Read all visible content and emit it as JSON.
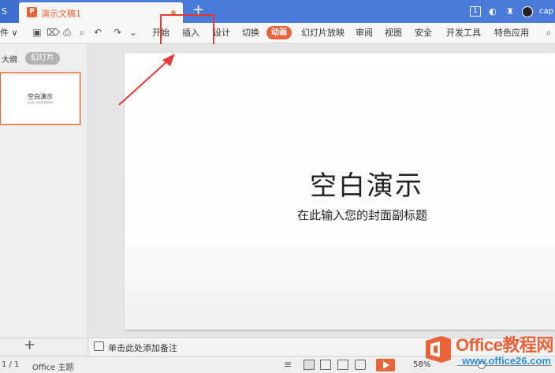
{
  "titlebar": {
    "left_tab_label": "S",
    "doc_icon_letter": "P",
    "doc_title": "演示文稿1",
    "new_tab_symbol": "+",
    "page_badge": "1",
    "username": "cap"
  },
  "ribbon": {
    "file_label": "件",
    "tabs": [
      "开始",
      "插入",
      "设计",
      "切换",
      "动画",
      "幻灯片放映",
      "审阅",
      "视图",
      "安全",
      "开发工具",
      "特色应用"
    ],
    "active_tab": "动画",
    "highlighted_tab": "插入"
  },
  "left_panel": {
    "outline_label": "大纲",
    "slides_label": "幻灯片",
    "thumb_title": "空白演示",
    "thumb_subtitle": "在此输入您的封面副标题",
    "add_symbol": "+"
  },
  "slide": {
    "title": "空白演示",
    "subtitle": "在此输入您的封面副标题"
  },
  "notes": {
    "placeholder": "单击此处添加备注"
  },
  "statusbar": {
    "page": "1 / 1",
    "theme": "Office 主题",
    "zoom": "58%",
    "zoom_level": 0.58
  },
  "watermark": {
    "line1": "Office教程网",
    "line2": "www.office26.com"
  },
  "colors": {
    "titlebar": "#4a7bd9",
    "accent": "#e8623a",
    "highlight": "#e53935",
    "watermark_blue": "#2b8fd6"
  }
}
